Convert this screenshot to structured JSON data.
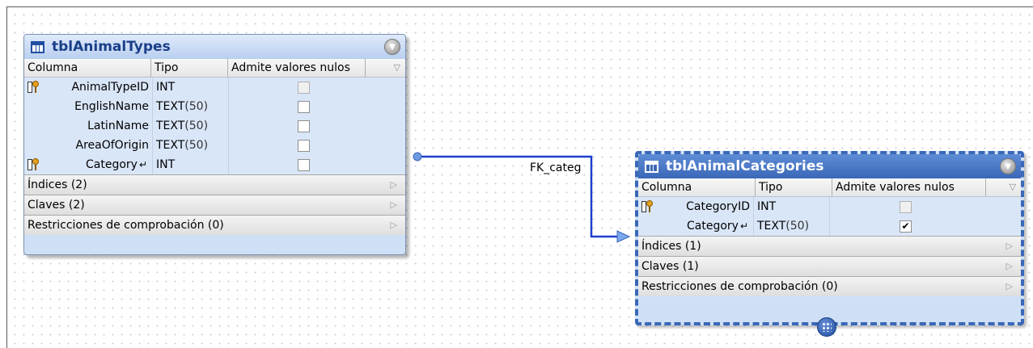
{
  "canvas": {
    "fk_label": "FK_categ"
  },
  "tables": {
    "left": {
      "title": "tblAnimalTypes",
      "headers": {
        "column": "Columna",
        "type": "Tipo",
        "nullable": "Admite valores nulos"
      },
      "rows": [
        {
          "name": "AnimalTypeID",
          "type": "INT",
          "len": "",
          "pk": true,
          "fk": false,
          "checked": false,
          "disabled": true
        },
        {
          "name": "EnglishName",
          "type": "TEXT",
          "len": "(50)",
          "pk": false,
          "fk": false,
          "checked": false,
          "disabled": false
        },
        {
          "name": "LatinName",
          "type": "TEXT",
          "len": "(50)",
          "pk": false,
          "fk": false,
          "checked": false,
          "disabled": false
        },
        {
          "name": "AreaOfOrigin",
          "type": "TEXT",
          "len": "(50)",
          "pk": false,
          "fk": false,
          "checked": false,
          "disabled": false
        },
        {
          "name": "Category",
          "type": "INT",
          "len": "",
          "pk": true,
          "fk": true,
          "checked": false,
          "disabled": false
        }
      ],
      "sections": [
        "Índices (2)",
        "Claves (2)",
        "Restricciones de comprobación (0)"
      ]
    },
    "right": {
      "title": "tblAnimalCategories",
      "headers": {
        "column": "Columna",
        "type": "Tipo",
        "nullable": "Admite valores nulos"
      },
      "rows": [
        {
          "name": "CategoryID",
          "type": "INT",
          "len": "",
          "pk": true,
          "fk": false,
          "checked": false,
          "disabled": true
        },
        {
          "name": "Category",
          "type": "TEXT",
          "len": "(50)",
          "pk": false,
          "fk": true,
          "checked": true,
          "disabled": false
        }
      ],
      "sections": [
        "Índices (1)",
        "Claves (1)",
        "Restricciones de comprobación (0)"
      ]
    }
  }
}
